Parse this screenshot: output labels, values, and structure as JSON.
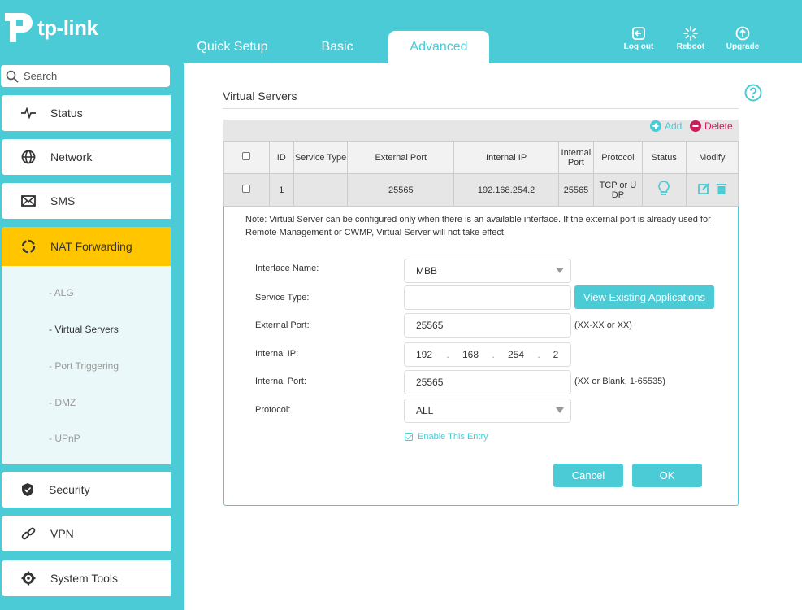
{
  "brand": {
    "name": "tp-link",
    "accent": "#4acbd6",
    "active": "#ffc600"
  },
  "nav": {
    "tabs": [
      {
        "label": "Quick Setup"
      },
      {
        "label": "Basic"
      },
      {
        "label": "Advanced",
        "active": true
      }
    ],
    "actions": [
      {
        "label": "Log out",
        "icon": "logout-icon"
      },
      {
        "label": "Reboot",
        "icon": "reboot-icon"
      },
      {
        "label": "Upgrade",
        "icon": "upgrade-icon"
      }
    ]
  },
  "sidebar": {
    "search_placeholder": "Search",
    "items": [
      {
        "label": "Status",
        "icon": "status-icon"
      },
      {
        "label": "Network",
        "icon": "globe-icon"
      },
      {
        "label": "SMS",
        "icon": "mail-icon"
      },
      {
        "label": "NAT Forwarding",
        "icon": "nat-icon",
        "active": true
      },
      {
        "label": "Security",
        "icon": "shield-icon"
      },
      {
        "label": "VPN",
        "icon": "link-icon"
      },
      {
        "label": "System Tools",
        "icon": "gear-icon"
      }
    ],
    "subitems": [
      {
        "label": "- ALG"
      },
      {
        "label": "- Virtual Servers",
        "active": true
      },
      {
        "label": "- Port Triggering"
      },
      {
        "label": "- DMZ"
      },
      {
        "label": "- UPnP"
      }
    ]
  },
  "main": {
    "title": "Virtual Servers",
    "toolbar": {
      "add": "Add",
      "delete": "Delete"
    },
    "table": {
      "headers": [
        "ID",
        "Service Type",
        "External Port",
        "Internal IP",
        "Internal Port",
        "Protocol",
        "Status",
        "Modify"
      ],
      "rows": [
        {
          "id": "1",
          "service_type": "",
          "external_port": "25565",
          "internal_ip": "192.168.254.2",
          "internal_port": "25565",
          "protocol": "TCP or U DP"
        }
      ]
    },
    "note": "Note: Virtual Server can be configured only when there is an available interface. If the external port is already used for Remote Management or CWMP, Virtual Server will not take effect.",
    "form": {
      "interface_name": {
        "label": "Interface Name:",
        "value": "MBB"
      },
      "service_type": {
        "label": "Service Type:",
        "value": "",
        "button": "View Existing Applications"
      },
      "external_port": {
        "label": "External Port:",
        "value": "25565",
        "hint": "(XX-XX or XX)"
      },
      "internal_ip": {
        "label": "Internal IP:",
        "octets": [
          "192",
          "168",
          "254",
          "2"
        ]
      },
      "internal_port": {
        "label": "Internal Port:",
        "value": "25565",
        "hint": "(XX or Blank, 1-65535)"
      },
      "protocol": {
        "label": "Protocol:",
        "value": "ALL"
      },
      "enable": {
        "label": "Enable This Entry",
        "checked": true
      }
    },
    "buttons": {
      "cancel": "Cancel",
      "ok": "OK"
    }
  }
}
